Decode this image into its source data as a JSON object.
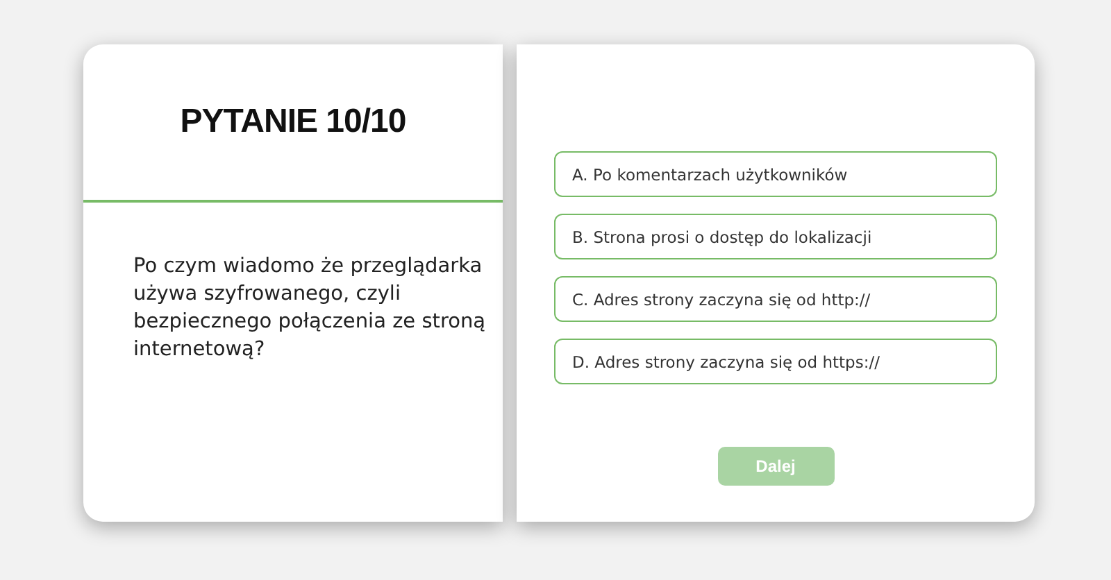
{
  "question": {
    "title": "PYTANIE 10/10",
    "text": "Po czym wiadomo że przeglądarka używa szyfrowanego, czyli bezpiecznego połączenia ze stroną internetową?"
  },
  "answers": [
    {
      "label": "A. Po komentarzach użytkowników",
      "selected": false
    },
    {
      "label": "B. Strona prosi o dostęp do lokalizacji",
      "selected": false
    },
    {
      "label": "C. Adres strony zaczyna się od http://",
      "selected": false
    },
    {
      "label": "D. Adres strony zaczyna się od https://",
      "selected": false
    }
  ],
  "next_button": {
    "label": "Dalej",
    "disabled": true
  }
}
